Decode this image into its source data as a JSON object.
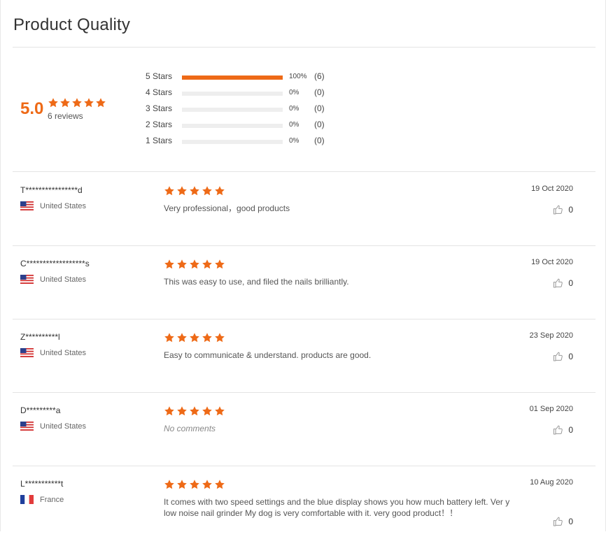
{
  "section_title": "Product Quality",
  "summary": {
    "average": "5.0",
    "stars": 5,
    "reviews_label": "6 reviews"
  },
  "distribution": [
    {
      "label": "5 Stars",
      "percent_value": 100,
      "percent": "100%",
      "count": "(6)"
    },
    {
      "label": "4 Stars",
      "percent_value": 0,
      "percent": "0%",
      "count": "(0)"
    },
    {
      "label": "3 Stars",
      "percent_value": 0,
      "percent": "0%",
      "count": "(0)"
    },
    {
      "label": "2 Stars",
      "percent_value": 0,
      "percent": "0%",
      "count": "(0)"
    },
    {
      "label": "1 Stars",
      "percent_value": 0,
      "percent": "0%",
      "count": "(0)"
    }
  ],
  "reviews": [
    {
      "name": "T****************d",
      "country": "United States",
      "flag": "us-flag-icon",
      "rating": 5,
      "text": "Very professional，good products",
      "date": "19 Oct 2020",
      "likes": "0"
    },
    {
      "name": "C******************s",
      "country": "United States",
      "flag": "us-flag-icon",
      "rating": 5,
      "text": "This was easy to use, and filed the nails brilliantly.",
      "date": "19 Oct 2020",
      "likes": "0"
    },
    {
      "name": "Z**********l",
      "country": "United States",
      "flag": "us-flag-icon",
      "rating": 5,
      "text": "Easy to communicate & understand. products are good.",
      "date": "23 Sep 2020",
      "likes": "0"
    },
    {
      "name": "D*********a",
      "country": "United States",
      "flag": "us-flag-icon",
      "rating": 5,
      "text": "No comments",
      "date": "01 Sep 2020",
      "likes": "0"
    },
    {
      "name": "L***********t",
      "country": "France",
      "flag": "fr-flag-icon",
      "rating": 5,
      "text": "It comes with two speed settings and the blue display shows you how much battery left. Ver y low noise nail grinder My dog is very comfortable with it.  very good product！！",
      "date": "10 Aug 2020",
      "likes": "0"
    }
  ],
  "colors": {
    "accent": "#ee6a17",
    "bar_track": "#eeeeee",
    "divider": "#e4e4e4"
  }
}
